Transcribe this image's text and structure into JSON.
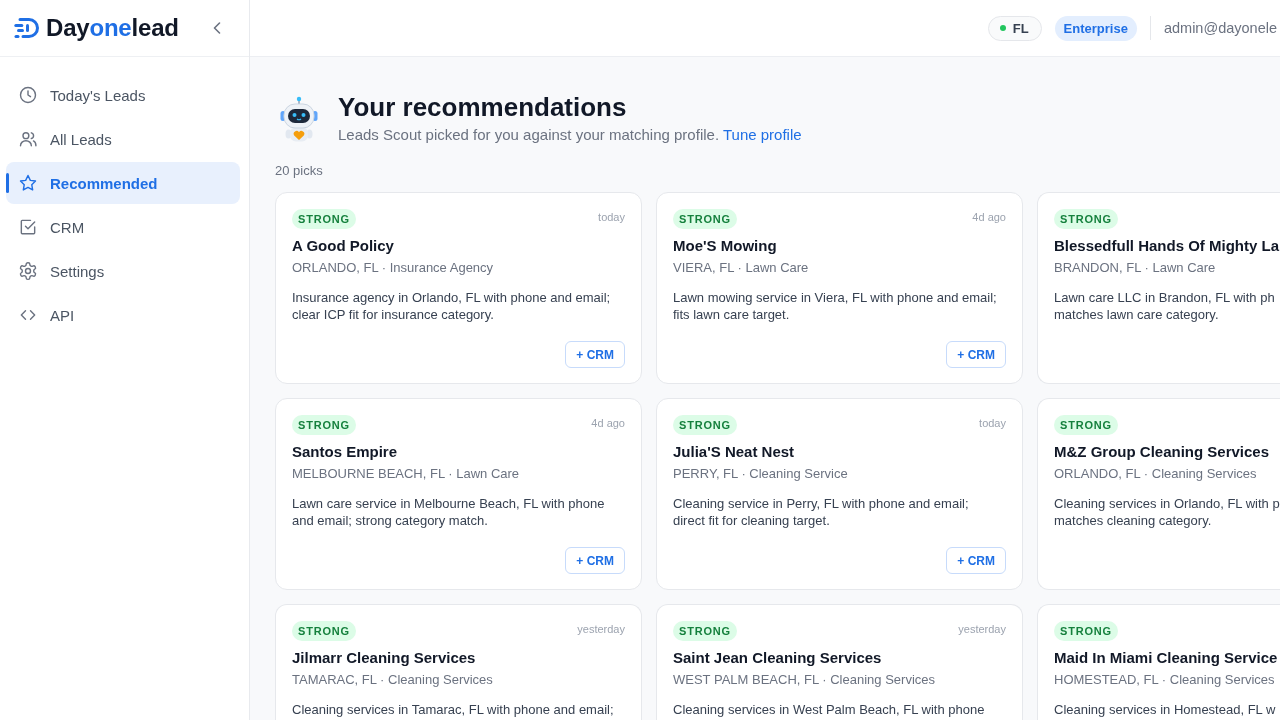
{
  "sidebar": {
    "logo": [
      {
        "text": "Day",
        "accent": false
      },
      {
        "text": "one",
        "accent": true
      },
      {
        "text": "lead",
        "accent": false
      }
    ],
    "nav": [
      {
        "label": "Today's Leads",
        "selected": false
      },
      {
        "label": "All Leads",
        "selected": false
      },
      {
        "label": "Recommended",
        "selected": true
      },
      {
        "label": "CRM",
        "selected": false
      },
      {
        "label": "Settings",
        "selected": false
      },
      {
        "label": "API",
        "selected": false
      }
    ]
  },
  "topbar": {
    "region": "FL",
    "plan": "Enterprise",
    "user": "admin@dayonele"
  },
  "header": {
    "title": "Your recommendations",
    "subtitle": "Leads Scout picked for you against your matching profile.",
    "link": "Tune profile",
    "count": "20 picks"
  },
  "cards": [
    {
      "strength": "STRONG",
      "time": "today",
      "name": "A Good Policy",
      "location": "ORLANDO, FL · Insurance Agency",
      "description": [
        "Insurance agency in Orlando, FL with phone and email;",
        "clear ICP fit for insurance category."
      ],
      "action": "+ CRM"
    },
    {
      "strength": "STRONG",
      "time": "4d ago",
      "name": "Moe'S Mowing",
      "location": "VIERA, FL · Lawn Care",
      "description": [
        "Lawn mowing service in Viera, FL with phone and email;",
        "fits lawn care target."
      ],
      "action": "+ CRM"
    },
    {
      "strength": "STRONG",
      "name": "Blessedfull Hands Of Mighty La",
      "location": "BRANDON, FL · Lawn Care",
      "description": [
        "Lawn care LLC in Brandon, FL with ph",
        "matches lawn care category."
      ]
    },
    {
      "strength": "STRONG",
      "time": "4d ago",
      "name": "Santos Empire",
      "location": "MELBOURNE BEACH, FL · Lawn Care",
      "description": [
        "Lawn care service in Melbourne Beach, FL with phone",
        "and email; strong category match."
      ],
      "action": "+ CRM"
    },
    {
      "strength": "STRONG",
      "time": "today",
      "name": "Julia'S Neat Nest",
      "location": "PERRY, FL · Cleaning Service",
      "description": [
        "Cleaning service in Perry, FL with phone and email;",
        "direct fit for cleaning target."
      ],
      "action": "+ CRM"
    },
    {
      "strength": "STRONG",
      "name": "M&Z Group Cleaning Services",
      "location": "ORLANDO, FL · Cleaning Services",
      "description": [
        "Cleaning services in Orlando, FL with p",
        "matches cleaning category."
      ]
    },
    {
      "strength": "STRONG",
      "time": "yesterday",
      "name": "Jilmarr Cleaning Services",
      "location": "TAMARAC, FL · Cleaning Services",
      "description": [
        "Cleaning services in Tamarac, FL with phone and email;"
      ]
    },
    {
      "strength": "STRONG",
      "time": "yesterday",
      "name": "Saint Jean Cleaning Services",
      "location": "WEST PALM BEACH, FL · Cleaning Services",
      "description": [
        "Cleaning services in West Palm Beach, FL with phone"
      ]
    },
    {
      "strength": "STRONG",
      "name": "Maid In Miami Cleaning Service",
      "location": "HOMESTEAD, FL · Cleaning Services",
      "description": [
        "Cleaning services in Homestead, FL w"
      ]
    }
  ]
}
